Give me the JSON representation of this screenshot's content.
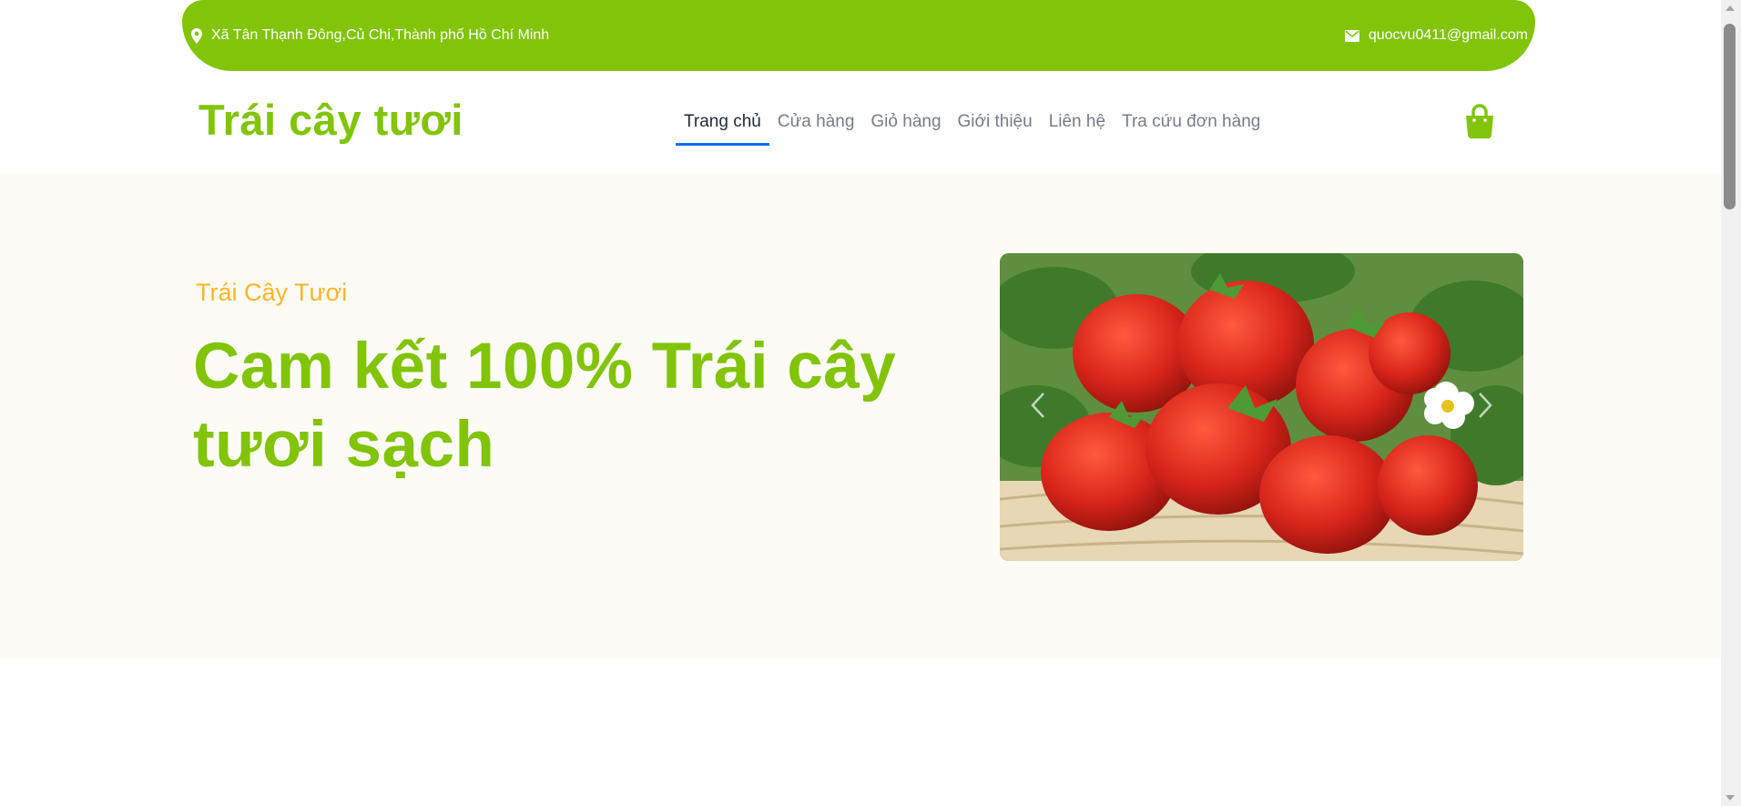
{
  "topbar": {
    "address": "Xã Tân Thạnh Đông,Củ Chi,Thành phố Hồ Chí Minh",
    "address_icon": "map-marker-icon",
    "email": "quocvu0411@gmail.com",
    "email_icon": "envelope-icon",
    "background": "#81c408"
  },
  "navbar": {
    "brand": "Trái cây tươi",
    "links": [
      {
        "label": "Trang chủ",
        "active": true
      },
      {
        "label": "Cửa hàng",
        "active": false
      },
      {
        "label": "Giỏ hàng",
        "active": false
      },
      {
        "label": "Giới thiệu",
        "active": false
      },
      {
        "label": "Liên hệ",
        "active": false
      },
      {
        "label": "Tra cứu đơn hàng",
        "active": false
      }
    ],
    "cart_icon": "shopping-bag-icon",
    "active_underline_color": "#0d6efd"
  },
  "hero": {
    "eyebrow": "Trái Cây Tươi",
    "headline": "Cam kết 100% Trái cây tươi sạch",
    "carousel": {
      "image": "strawberries-basket",
      "prev_icon": "chevron-left-icon",
      "next_icon": "chevron-right-icon"
    }
  },
  "colors": {
    "brand_green": "#81c408",
    "accent_orange": "#ffb524",
    "hero_bg": "#fdfbf6"
  }
}
